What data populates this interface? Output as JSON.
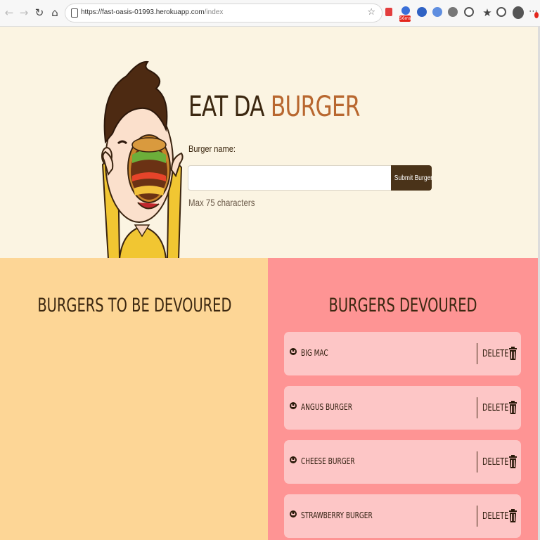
{
  "browser": {
    "url_host": "https://fast-oasis-01993.herokuapp.com",
    "url_path": "/index",
    "extension_badge": "56ms"
  },
  "hero": {
    "title_part1": "EAT DA",
    "title_part2": "BURGER",
    "input_label": "Burger name:",
    "input_value": "",
    "submit_label": "Submit Burger",
    "max_note": "Max 75 characters"
  },
  "panels": {
    "to_be_devoured_heading": "BURGERS TO BE DEVOURED",
    "devoured_heading": "BURGERS DEVOURED"
  },
  "devoured": [
    {
      "name": "BIG MAC",
      "delete_label": "DELETE"
    },
    {
      "name": "ANGUS BURGER",
      "delete_label": "DELETE"
    },
    {
      "name": "CHEESE BURGER",
      "delete_label": "DELETE"
    },
    {
      "name": "STRAWBERRY BURGER",
      "delete_label": "DELETE"
    }
  ],
  "colors": {
    "hero_bg": "#fbf4e2",
    "left_panel_bg": "#fdd696",
    "right_panel_bg": "#fe9494",
    "card_bg": "#fdc6c6",
    "title_dark": "#3b2710",
    "title_accent": "#b8672f",
    "button_bg": "#4a3319"
  },
  "icons": {
    "card_icon": "smiley-icon",
    "delete_icon": "trash-icon"
  }
}
